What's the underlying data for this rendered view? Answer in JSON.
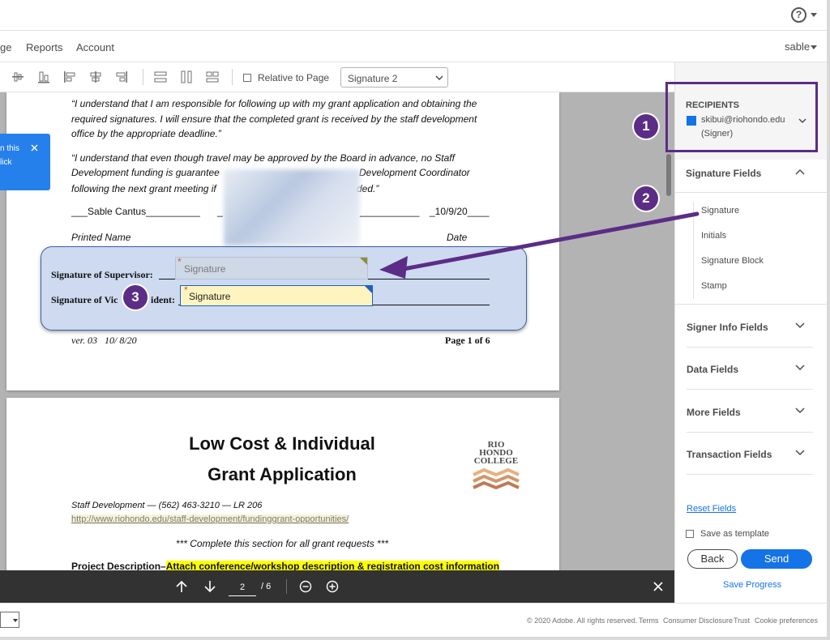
{
  "topbar": {
    "help_label": "?"
  },
  "nav": {
    "items": [
      "ge",
      "Reports",
      "Account"
    ],
    "user": "sable"
  },
  "toolbar": {
    "relative_label": "Relative to Page",
    "recipient_select": "Signature 2"
  },
  "toast": {
    "line1": "n this",
    "line2": "lick"
  },
  "page1": {
    "para1": "“I understand that I am responsible for following up with my grant application and obtaining the required signatures. I will ensure that the completed grant is received by the staff development office by the appropriate deadline.”",
    "para2a": "“I understand that even though travel may be approved by the Board in advance, no Staff",
    "para2b": "Development funding is guarantee",
    "para2b_end": "Development Coordinator",
    "para2c": "following the next grant meeting if",
    "para2c_end": "ded.”",
    "name_line": "___Sable Cantus__________",
    "name_line2": "_",
    "date_line_a": "___________",
    "date_line": "_10/9/20____",
    "printed_name": "Printed Name",
    "date_label": "Date",
    "sup_label": "Signature of Supervisor:",
    "vp_label": "Signature of Vic",
    "vp_label_end": "ident:",
    "sig_field1": "Signature",
    "sig_field2": "Signature",
    "version": "ver. 03   10/ 8/20",
    "pageof": "Page 1 of 6"
  },
  "page2": {
    "title1": "Low Cost & Individual",
    "title2": "Grant Application",
    "logo": [
      "RIO",
      "HONDO",
      "COLLEGE"
    ],
    "contact": "Staff Development — (562) 463-3210 —  LR 206",
    "url": "http://www.riohondo.edu/staff-development/fundinggrant-opportunities/",
    "complete": "*** Complete this section for all grant requests ***",
    "proj_label": "Project Description–",
    "proj_high": "Attach conference/workshop description & registration cost information"
  },
  "panel": {
    "recipients_title": "RECIPIENTS",
    "recipient_email": "skibui@riohondo.edu",
    "recipient_role": "(Signer)",
    "sig_fields_title": "Signature Fields",
    "sig_fields": [
      "Signature",
      "Initials",
      "Signature Block",
      "Stamp"
    ],
    "sections": [
      "Signer Info Fields",
      "Data Fields",
      "More Fields",
      "Transaction Fields"
    ],
    "reset": "Reset Fields",
    "save_template": "Save as template",
    "back": "Back",
    "send": "Send",
    "save_progress": "Save Progress"
  },
  "pagenav": {
    "current": "2",
    "total": "/ 6"
  },
  "footer": {
    "copyright": "© 2020 Adobe. All rights reserved.",
    "links": [
      "Terms",
      "Consumer Disclosure",
      "Trust",
      "Cookie preferences"
    ]
  },
  "callouts": [
    "1",
    "2",
    "3"
  ],
  "colors": {
    "accent": "#1473e6",
    "callout": "#5b2d86",
    "toast": "#2680eb",
    "highlight": "#ffff00"
  }
}
